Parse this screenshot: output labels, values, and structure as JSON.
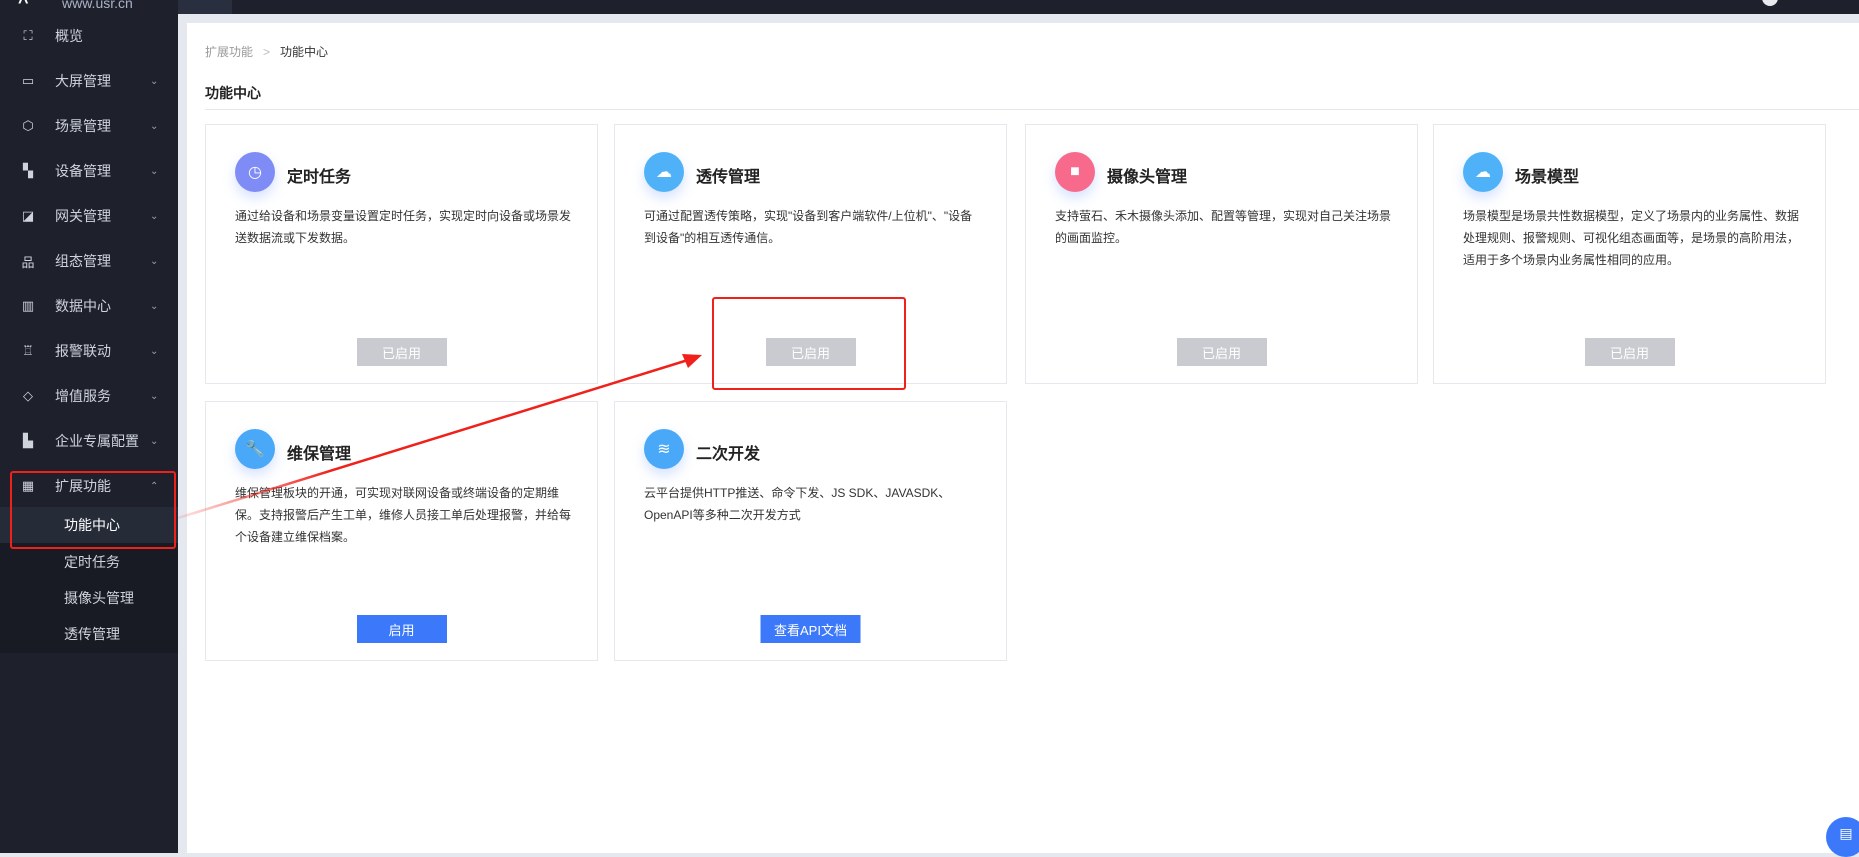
{
  "logo": {
    "url_text": "www.usr.cn",
    "mark": "^"
  },
  "sidebar": {
    "items": [
      {
        "label": "概览",
        "icon": "overview-icon",
        "glyph": "⛶",
        "chevron": ""
      },
      {
        "label": "大屏管理",
        "icon": "monitor-icon",
        "glyph": "▭",
        "chevron": "⌄"
      },
      {
        "label": "场景管理",
        "icon": "cube-icon",
        "glyph": "⬡",
        "chevron": "⌄"
      },
      {
        "label": "设备管理",
        "icon": "device-icon",
        "glyph": "▚",
        "chevron": "⌄"
      },
      {
        "label": "网关管理",
        "icon": "gateway-icon",
        "glyph": "◪",
        "chevron": "⌄"
      },
      {
        "label": "组态管理",
        "icon": "topology-icon",
        "glyph": "品",
        "chevron": "⌄"
      },
      {
        "label": "数据中心",
        "icon": "bar-chart-icon",
        "glyph": "▥",
        "chevron": "⌄"
      },
      {
        "label": "报警联动",
        "icon": "alarm-icon",
        "glyph": "♖",
        "chevron": "⌄"
      },
      {
        "label": "增值服务",
        "icon": "diamond-icon",
        "glyph": "◇",
        "chevron": "⌄"
      },
      {
        "label": "企业专属配置",
        "icon": "building-icon",
        "glyph": "▙",
        "chevron": "⌄"
      },
      {
        "label": "扩展功能",
        "icon": "grid-icon",
        "glyph": "▦",
        "chevron": "⌃"
      }
    ],
    "submenu": [
      "功能中心",
      "定时任务",
      "摄像头管理",
      "透传管理"
    ]
  },
  "breadcrumb": {
    "parent": "扩展功能",
    "separator": ">",
    "current": "功能中心"
  },
  "page_title": "功能中心",
  "cards": [
    {
      "title": "定时任务",
      "icon": "clock-icon",
      "glyph": "◷",
      "color": "#7f8cf5",
      "desc": "通过给设备和场景变量设置定时任务，实现定时向设备或场景发送数据流或下发数据。",
      "button": "已启用",
      "state": "disabled"
    },
    {
      "title": "透传管理",
      "icon": "cloud-transfer-icon",
      "glyph": "☁",
      "color": "#4fb2f8",
      "desc": "可通过配置透传策略，实现\"设备到客户端软件/上位机\"、\"设备到设备\"的相互透传通信。",
      "button": "已启用",
      "state": "disabled"
    },
    {
      "title": "摄像头管理",
      "icon": "camera-icon",
      "glyph": "■",
      "color": "#f76a8c",
      "desc": "支持萤石、禾木摄像头添加、配置等管理，实现对自己关注场景的画面监控。",
      "button": "已启用",
      "state": "disabled"
    },
    {
      "title": "场景模型",
      "icon": "cloud-model-icon",
      "glyph": "☁",
      "color": "#4fb2f8",
      "desc": "场景模型是场景共性数据模型，定义了场景内的业务属性、数据处理规则、报警规则、可视化组态画面等，是场景的高阶用法，适用于多个场景内业务属性相同的应用。",
      "button": "已启用",
      "state": "disabled"
    },
    {
      "title": "维保管理",
      "icon": "wrench-icon",
      "glyph": "🔧",
      "color": "#4aa8f8",
      "desc": "维保管理板块的开通，可实现对联网设备或终端设备的定期维保。支持报警后产生工单，维修人员接工单后处理报警，并给每个设备建立维保档案。",
      "button": "启用",
      "state": "primary"
    },
    {
      "title": "二次开发",
      "icon": "layers-icon",
      "glyph": "≋",
      "color": "#4aa8f8",
      "desc": "云平台提供HTTP推送、命令下发、JS SDK、JAVASDK、OpenAPI等多种二次开发方式",
      "button": "查看API文档",
      "state": "primary"
    }
  ],
  "float_button": {
    "icon": "document-icon",
    "glyph": "▤"
  },
  "colors": {
    "accent": "#3c79fa",
    "annotation": "#f0201a",
    "sidebar_bg": "#1e212b"
  }
}
